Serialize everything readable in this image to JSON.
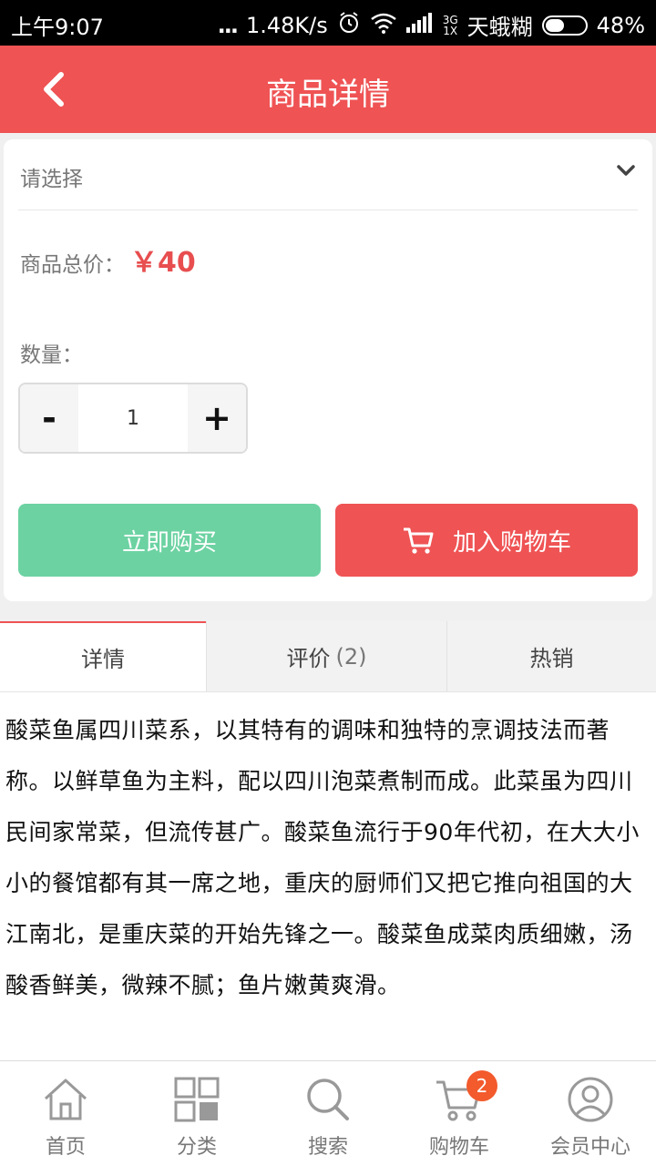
{
  "status_bar": {
    "time": "上午9:07",
    "dots": "...",
    "net_speed": "1.48K/s",
    "network_type_top": "3G",
    "network_type_bottom": "1X",
    "carrier": "天蛾糊",
    "battery": "48%"
  },
  "header": {
    "title": "商品详情",
    "back_icon": "chevron-left-icon"
  },
  "product": {
    "select_placeholder": "请选择",
    "price_label": "商品总价：",
    "price_value": "￥40",
    "quantity_label": "数量：",
    "quantity_minus": "-",
    "quantity_value": "1",
    "quantity_plus": "+",
    "buy_now": "立即购买",
    "add_to_cart": "加入购物车"
  },
  "tabs": [
    {
      "label": "详情",
      "count": ""
    },
    {
      "label": "评价",
      "count": "(2)"
    },
    {
      "label": "热销",
      "count": ""
    }
  ],
  "description": "酸菜鱼属四川菜系，以其特有的调味和独特的烹调技法而著称。以鲜草鱼为主料，配以四川泡菜煮制而成。此菜虽为四川民间家常菜，但流传甚广。酸菜鱼流行于90年代初，在大大小小的餐馆都有其一席之地，重庆的厨师们又把它推向祖国的大江南北，是重庆菜的开始先锋之一。酸菜鱼成菜肉质细嫩，汤酸香鲜美，微辣不腻；鱼片嫩黄爽滑。",
  "bottom_nav": [
    {
      "label": "首页",
      "icon": "home-icon"
    },
    {
      "label": "分类",
      "icon": "category-grid-icon"
    },
    {
      "label": "搜索",
      "icon": "search-icon"
    },
    {
      "label": "购物车",
      "icon": "cart-icon",
      "badge": "2"
    },
    {
      "label": "会员中心",
      "icon": "user-icon"
    }
  ],
  "colors": {
    "brand_red": "#ef5354",
    "buy_green": "#6cd2a2",
    "badge_orange": "#f35a2c"
  }
}
